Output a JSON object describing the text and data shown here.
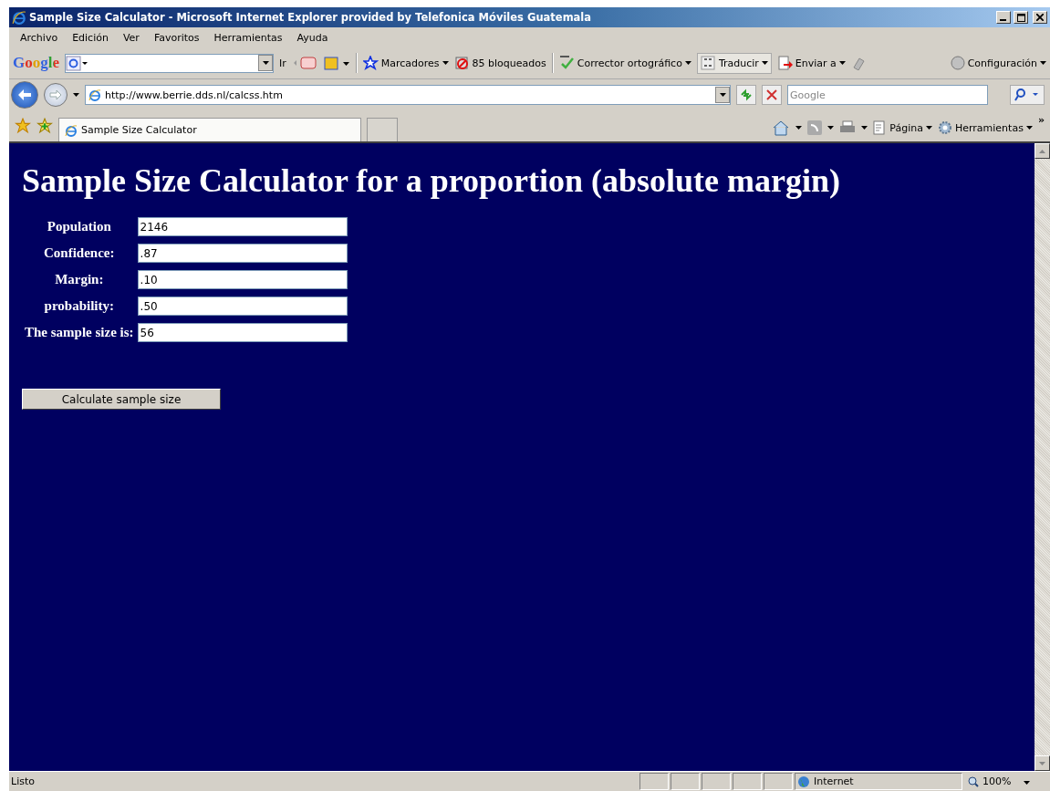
{
  "window": {
    "title": "Sample Size Calculator - Microsoft Internet Explorer provided by Telefonica Móviles Guatemala"
  },
  "menu": [
    "Archivo",
    "Edición",
    "Ver",
    "Favoritos",
    "Herramientas",
    "Ayuda"
  ],
  "google_toolbar": {
    "logo": "Google",
    "go_label": "Ir",
    "items": [
      {
        "label": "Marcadores",
        "dropdown": true
      },
      {
        "label": "85 bloqueados",
        "dropdown": false
      },
      {
        "label": "Corrector ortográfico",
        "dropdown": true
      },
      {
        "label": "Traducir",
        "dropdown": true
      },
      {
        "label": "Enviar a",
        "dropdown": true
      }
    ],
    "settings": "Configuración"
  },
  "address_bar": {
    "url": "http://www.berrie.dds.nl/calcss.htm",
    "search_placeholder": "Google"
  },
  "tabs": [
    {
      "label": "Sample Size Calculator",
      "selected": true
    }
  ],
  "command_bar": {
    "items": [
      "Página",
      "Herramientas"
    ],
    "more": "»"
  },
  "page": {
    "heading": "Sample Size Calculator for a proportion (absolute margin)",
    "fields": [
      {
        "label": "Population",
        "value": "2146"
      },
      {
        "label": "Confidence:",
        "value": ".87"
      },
      {
        "label": "Margin:",
        "value": ".10"
      },
      {
        "label": "probability:",
        "value": ".50"
      },
      {
        "label": "The sample size is:",
        "value": "56"
      }
    ],
    "button": "Calculate sample size"
  },
  "status_bar": {
    "text": "Listo",
    "zone": "Internet",
    "zoom": "100%"
  }
}
